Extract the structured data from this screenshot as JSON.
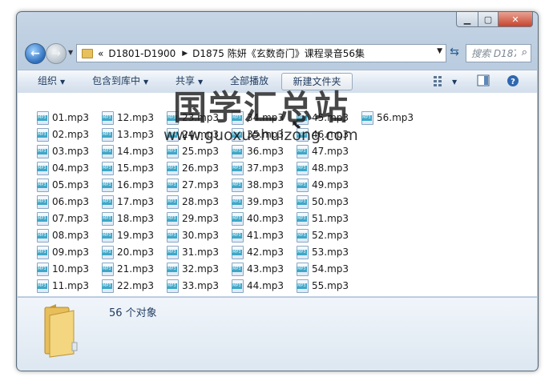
{
  "address": {
    "overflow": "«",
    "crumbs": [
      "D1801-D1900",
      "D1875 陈妍《玄数奇门》课程录音56集"
    ]
  },
  "search": {
    "placeholder": "搜索 D187..."
  },
  "toolbar": {
    "organize": "组织",
    "include": "包含到库中",
    "share": "共享",
    "playall": "全部播放",
    "newfolder": "新建文件夹"
  },
  "files": [
    [
      "01.mp3",
      "02.mp3",
      "03.mp3",
      "04.mp3",
      "05.mp3",
      "06.mp3",
      "07.mp3",
      "08.mp3",
      "09.mp3",
      "10.mp3",
      "11.mp3"
    ],
    [
      "12.mp3",
      "13.mp3",
      "14.mp3",
      "15.mp3",
      "16.mp3",
      "17.mp3",
      "18.mp3",
      "19.mp3",
      "20.mp3",
      "21.mp3",
      "22.mp3"
    ],
    [
      "23.mp3",
      "24.mp3",
      "25.mp3",
      "26.mp3",
      "27.mp3",
      "28.mp3",
      "29.mp3",
      "30.mp3",
      "31.mp3",
      "32.mp3",
      "33.mp3"
    ],
    [
      "34.mp3",
      "35.mp3",
      "36.mp3",
      "37.mp3",
      "38.mp3",
      "39.mp3",
      "40.mp3",
      "41.mp3",
      "42.mp3",
      "43.mp3",
      "44.mp3"
    ],
    [
      "45.mp3",
      "46.mp3",
      "47.mp3",
      "48.mp3",
      "49.mp3",
      "50.mp3",
      "51.mp3",
      "52.mp3",
      "53.mp3",
      "54.mp3",
      "55.mp3"
    ],
    [
      "56.mp3"
    ]
  ],
  "watermark": {
    "title": "国学汇总站",
    "url": "www.guoxuehuizong.com"
  },
  "details": {
    "count": "56 个对象"
  },
  "colors": {
    "accent": "#1e3a5f",
    "close": "#c7432b",
    "mp3_badge": "#3fa7c8"
  }
}
